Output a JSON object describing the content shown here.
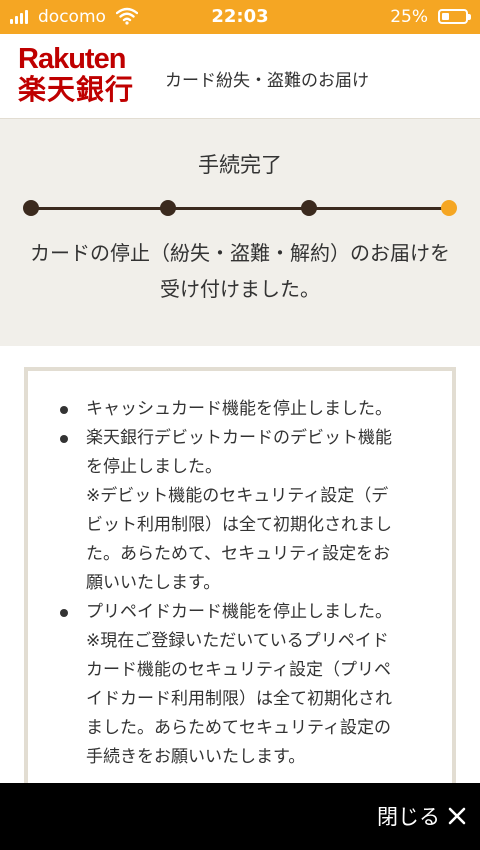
{
  "status_bar": {
    "carrier": "docomo",
    "time": "22:03",
    "battery_percent": "25%"
  },
  "header": {
    "logo_en": "Rakuten",
    "logo_jp": "楽天銀行",
    "page_title": "カード紛失・盗難のお届け"
  },
  "progress": {
    "title": "手続完了",
    "current_step": 4,
    "total_steps": 4,
    "message": "カードの停止（紛失・盗難・解約）のお届けを受け付けました。"
  },
  "info": {
    "items": [
      {
        "lines": [
          "キャッシュカード機能を停止しました。"
        ]
      },
      {
        "lines": [
          "楽天銀行デビットカードのデビット機能",
          "を停止しました。",
          "※デビット機能のセキュリティ設定（デ",
          "ビット利用制限）は全て初期化されまし",
          "た。あらためて、セキュリティ設定をお",
          "願いいたします。"
        ]
      },
      {
        "lines": [
          "プリペイドカード機能を停止しました。",
          "※現在ご登録いただいているプリペイド",
          "カード機能のセキュリティ設定（プリペ",
          "イドカード利用制限）は全て初期化され",
          "ました。あらためてセキュリティ設定の",
          "手続きをお願いいたします。"
        ]
      }
    ]
  },
  "footer": {
    "close_label": "閉じる"
  },
  "colors": {
    "status_bar": "#f5a623",
    "brand_red": "#bf0000",
    "progress_active": "#f5a623",
    "progress_done": "#3b2a1e",
    "section_bg": "#f1efea"
  }
}
